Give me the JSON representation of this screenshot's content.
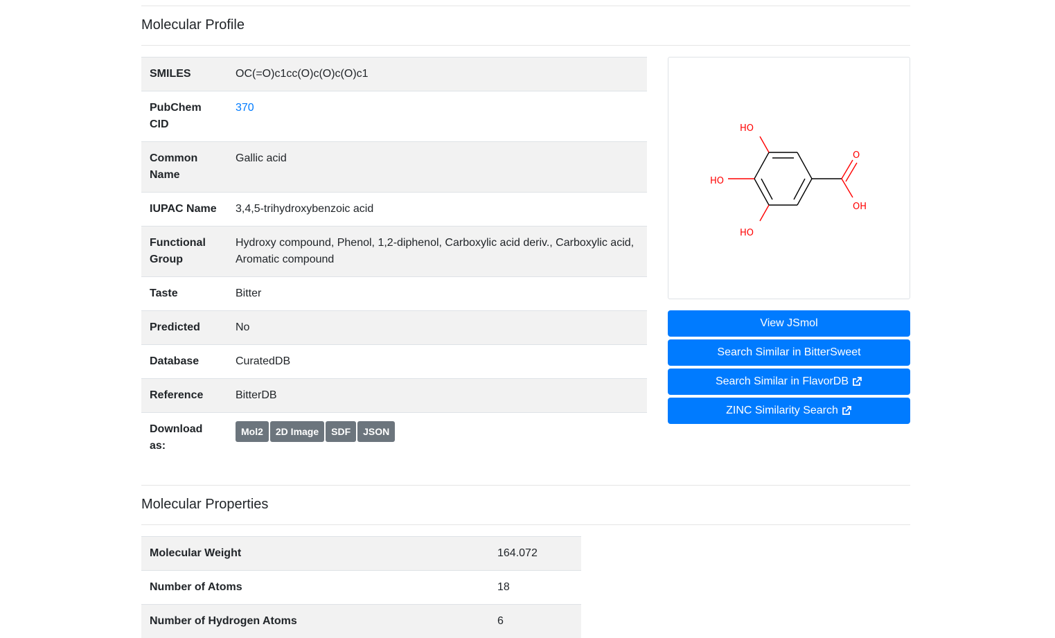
{
  "profile": {
    "title": "Molecular Profile",
    "rows": [
      {
        "label": "SMILES",
        "value": "OC(=O)c1cc(O)c(O)c(O)c1"
      },
      {
        "label": "PubChem CID",
        "value": "370"
      },
      {
        "label": "Common Name",
        "value": "Gallic acid"
      },
      {
        "label": "IUPAC Name",
        "value": "3,4,5-trihydroxybenzoic acid"
      },
      {
        "label": "Functional Group",
        "value": "Hydroxy compound, Phenol, 1,2-diphenol, Carboxylic acid deriv., Carboxylic acid, Aromatic compound"
      },
      {
        "label": "Taste",
        "value": "Bitter"
      },
      {
        "label": "Predicted",
        "value": "No"
      },
      {
        "label": "Database",
        "value": "CuratedDB"
      },
      {
        "label": "Reference",
        "value": "BitterDB"
      },
      {
        "label": "Download as:",
        "value": ""
      }
    ],
    "downloads": [
      "Mol2",
      "2D Image",
      "SDF",
      "JSON"
    ]
  },
  "structure": {
    "labels": [
      "HO",
      "HO",
      "HO",
      "O",
      "OH"
    ],
    "atom_color": "#ff0000"
  },
  "actions": [
    {
      "label": "View JSmol",
      "external": false
    },
    {
      "label": "Search Similar in BitterSweet",
      "external": false
    },
    {
      "label": "Search Similar in FlavorDB",
      "external": true
    },
    {
      "label": "ZINC Similarity Search",
      "external": true
    }
  ],
  "properties": {
    "title": "Molecular Properties",
    "rows": [
      {
        "label": "Molecular Weight",
        "value": "164.072"
      },
      {
        "label": "Number of Atoms",
        "value": "18"
      },
      {
        "label": "Number of Hydrogen Atoms",
        "value": "6"
      }
    ]
  },
  "colors": {
    "primary": "#007bff",
    "secondary": "#6c757d",
    "stripe": "#f2f2f2"
  }
}
